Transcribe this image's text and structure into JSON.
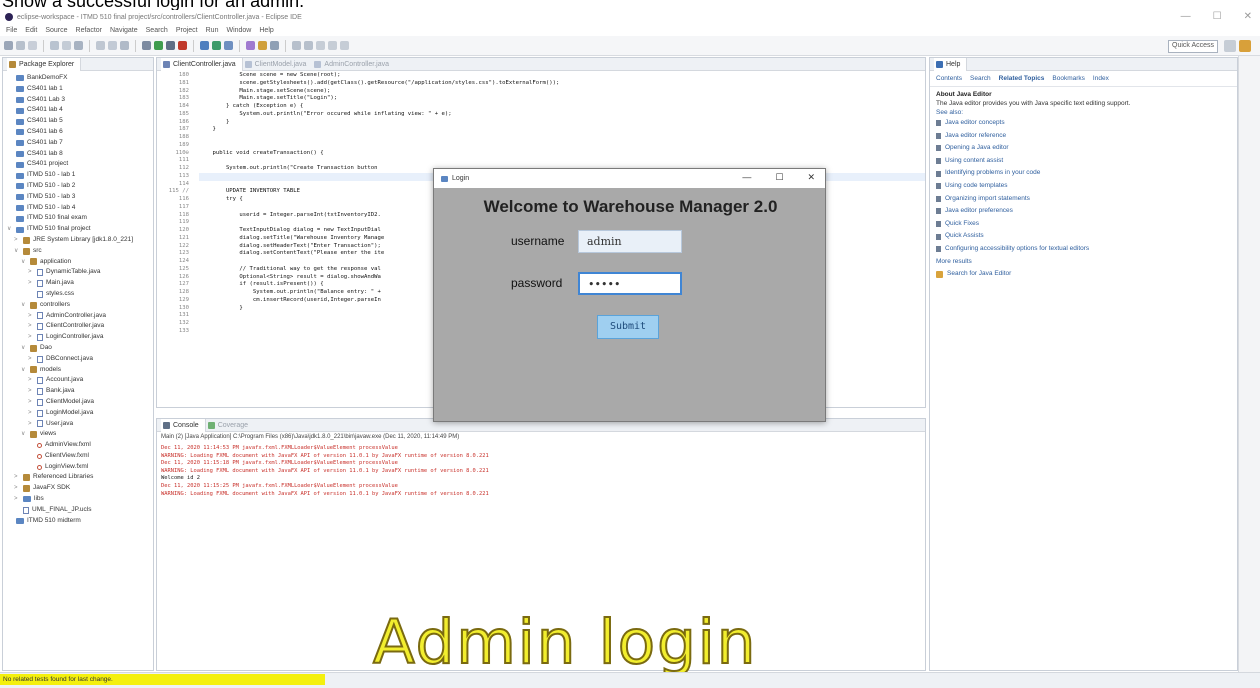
{
  "caption": "Show a successful login for an admin.",
  "window": {
    "title": "eclipse-workspace - ITMD 510 final project/src/controllers/ClientController.java - Eclipse IDE",
    "controls": [
      "—",
      "☐",
      "✕"
    ]
  },
  "menu": [
    "File",
    "Edit",
    "Source",
    "Refactor",
    "Navigate",
    "Search",
    "Project",
    "Run",
    "Window",
    "Help"
  ],
  "toolbar": {
    "quick_access": "Quick Access"
  },
  "package_explorer": {
    "tab": "Package Explorer",
    "items": [
      {
        "label": "BankDemoFX",
        "kind": "project",
        "depth": 0,
        "arrow": ""
      },
      {
        "label": "CS401 lab 1",
        "kind": "project",
        "depth": 0,
        "arrow": ""
      },
      {
        "label": "CS401 Lab 3",
        "kind": "project",
        "depth": 0,
        "arrow": ""
      },
      {
        "label": "CS401 lab 4",
        "kind": "project",
        "depth": 0,
        "arrow": ""
      },
      {
        "label": "CS401 lab 5",
        "kind": "project",
        "depth": 0,
        "arrow": ""
      },
      {
        "label": "CS401 lab 6",
        "kind": "project",
        "depth": 0,
        "arrow": ""
      },
      {
        "label": "CS401 lab 7",
        "kind": "project",
        "depth": 0,
        "arrow": ""
      },
      {
        "label": "CS401 lab 8",
        "kind": "project",
        "depth": 0,
        "arrow": ""
      },
      {
        "label": "CS401 project",
        "kind": "project",
        "depth": 0,
        "arrow": ""
      },
      {
        "label": "ITMD 510 - lab 1",
        "kind": "project",
        "depth": 0,
        "arrow": ""
      },
      {
        "label": "ITMD 510 - lab 2",
        "kind": "project",
        "depth": 0,
        "arrow": ""
      },
      {
        "label": "ITMD 510 - lab 3",
        "kind": "project",
        "depth": 0,
        "arrow": ""
      },
      {
        "label": "ITMD 510 - lab 4",
        "kind": "project",
        "depth": 0,
        "arrow": ""
      },
      {
        "label": "ITMD 510 final exam",
        "kind": "project",
        "depth": 0,
        "arrow": ""
      },
      {
        "label": "ITMD 510 final project",
        "kind": "project",
        "depth": 0,
        "arrow": "∨"
      },
      {
        "label": "JRE System Library [jdk1.8.0_221]",
        "kind": "lib",
        "depth": 1,
        "arrow": ">"
      },
      {
        "label": "src",
        "kind": "pkg",
        "depth": 1,
        "arrow": "∨"
      },
      {
        "label": "application",
        "kind": "pkg",
        "depth": 2,
        "arrow": "∨"
      },
      {
        "label": "DynamicTable.java",
        "kind": "java",
        "depth": 3,
        "arrow": ">"
      },
      {
        "label": "Main.java",
        "kind": "java",
        "depth": 3,
        "arrow": ">"
      },
      {
        "label": "styles.css",
        "kind": "css",
        "depth": 3,
        "arrow": ""
      },
      {
        "label": "controllers",
        "kind": "pkg",
        "depth": 2,
        "arrow": "∨"
      },
      {
        "label": "AdminController.java",
        "kind": "java",
        "depth": 3,
        "arrow": ">"
      },
      {
        "label": "ClientController.java",
        "kind": "java",
        "depth": 3,
        "arrow": ">"
      },
      {
        "label": "LoginController.java",
        "kind": "java",
        "depth": 3,
        "arrow": ">"
      },
      {
        "label": "Dao",
        "kind": "pkg",
        "depth": 2,
        "arrow": "∨"
      },
      {
        "label": "DBConnect.java",
        "kind": "java",
        "depth": 3,
        "arrow": ">"
      },
      {
        "label": "models",
        "kind": "pkg",
        "depth": 2,
        "arrow": "∨"
      },
      {
        "label": "Account.java",
        "kind": "java",
        "depth": 3,
        "arrow": ">"
      },
      {
        "label": "Bank.java",
        "kind": "java",
        "depth": 3,
        "arrow": ">"
      },
      {
        "label": "ClientModel.java",
        "kind": "java",
        "depth": 3,
        "arrow": ">"
      },
      {
        "label": "LoginModel.java",
        "kind": "java",
        "depth": 3,
        "arrow": ">"
      },
      {
        "label": "User.java",
        "kind": "java",
        "depth": 3,
        "arrow": ">"
      },
      {
        "label": "views",
        "kind": "pkg",
        "depth": 2,
        "arrow": "∨"
      },
      {
        "label": "AdminView.fxml",
        "kind": "fxml",
        "depth": 3,
        "arrow": ""
      },
      {
        "label": "ClientView.fxml",
        "kind": "fxml",
        "depth": 3,
        "arrow": ""
      },
      {
        "label": "LoginView.fxml",
        "kind": "fxml",
        "depth": 3,
        "arrow": ""
      },
      {
        "label": "Referenced Libraries",
        "kind": "lib",
        "depth": 1,
        "arrow": ">"
      },
      {
        "label": "JavaFX SDK",
        "kind": "lib",
        "depth": 1,
        "arrow": ">"
      },
      {
        "label": "libs",
        "kind": "folder",
        "depth": 1,
        "arrow": ">"
      },
      {
        "label": "UML_FINAL_JP.ucls",
        "kind": "file",
        "depth": 1,
        "arrow": ""
      },
      {
        "label": "ITMD 510 midterm",
        "kind": "project",
        "depth": 0,
        "arrow": ""
      }
    ]
  },
  "editor": {
    "tabs": [
      "ClientController.java",
      "ClientModel.java",
      "AdminController.java"
    ],
    "line_numbers": [
      "180",
      "181",
      "182",
      "183",
      "184",
      "185",
      "186",
      "187",
      "188",
      "189",
      "110⊖",
      "111",
      "112",
      "113",
      "114",
      "115 //",
      "116",
      "117",
      "118",
      "119",
      "120",
      "121",
      "122",
      "123",
      "124",
      "125",
      "126",
      "127",
      "128",
      "129",
      "130",
      "131",
      "132",
      "133"
    ],
    "lines": [
      "            Scene scene = new Scene(root);",
      "            scene.getStylesheets().add(getClass().getResource(\"/application/styles.css\").toExternalForm());",
      "            Main.stage.setScene(scene);",
      "            Main.stage.setTitle(\"Login\");",
      "        } catch (Exception e) {",
      "            System.out.println(\"Error occured while inflating view: \" + e);",
      "        }",
      "    }",
      "",
      "",
      "    public void createTransaction() {",
      "",
      "        System.out.println(\"Create Transaction button ",
      "",
      "",
      "        UPDATE INVENTORY TABLE",
      "        try {",
      "",
      "            userid = Integer.parseInt(txtInventoryID2.",
      "",
      "            TextInputDialog dialog = new TextInputDial",
      "            dialog.setTitle(\"Warehouse Inventory Manage",
      "            dialog.setHeaderText(\"Enter Transaction\");",
      "            dialog.setContentText(\"Please enter the ite",
      "",
      "            // Traditional way to get the response val",
      "            Optional<String> result = dialog.showAndWa",
      "            if (result.isPresent()) {",
      "                System.out.println(\"Balance entry: \" +",
      "                cm.insertRecord(userid,Integer.parseIn",
      "            }",
      "",
      "",
      ""
    ]
  },
  "console": {
    "tabs": [
      "Console",
      "Coverage"
    ],
    "path": "Main (2) [Java Application] C:\\Program Files (x86)\\Java\\jdk1.8.0_221\\bin\\javaw.exe (Dec 11, 2020, 11:14:49 PM)",
    "lines": [
      {
        "text": "Dec 11, 2020 11:14:53 PM javafx.fxml.FXMLLoader$ValueElement processValue",
        "color": "red"
      },
      {
        "text": "WARNING: Loading FXML document with JavaFX API of version 11.0.1 by JavaFX runtime of version 8.0.221",
        "color": "red"
      },
      {
        "text": "Dec 11, 2020 11:15:18 PM javafx.fxml.FXMLLoader$ValueElement processValue",
        "color": "red"
      },
      {
        "text": "WARNING: Loading FXML document with JavaFX API of version 11.0.1 by JavaFX runtime of version 8.0.221",
        "color": "red"
      },
      {
        "text": "Welcome id 2",
        "color": "black"
      },
      {
        "text": "Dec 11, 2020 11:15:25 PM javafx.fxml.FXMLLoader$ValueElement processValue",
        "color": "red"
      },
      {
        "text": "WARNING: Loading FXML document with JavaFX API of version 11.0.1 by JavaFX runtime of version 8.0.221",
        "color": "red"
      }
    ]
  },
  "help": {
    "tab": "Help",
    "tabs": [
      "Contents",
      "Search",
      "Related Topics",
      "Bookmarks",
      "Index"
    ],
    "heading": "About Java Editor",
    "description": "The Java editor provides you with Java specific text editing support.",
    "see_also": "See also:",
    "links": [
      "Java editor concepts",
      "Java editor reference",
      "Opening a Java editor",
      "Using content assist",
      "Identifying problems in your code",
      "Using code templates",
      "Organizing import statements",
      "Java editor preferences",
      "Quick Fixes",
      "Quick Assists",
      "Configuring accessibility options for textual editors"
    ],
    "more_results": "More results",
    "search_link": "Search for Java Editor"
  },
  "login_dialog": {
    "title": "Login",
    "controls": [
      "—",
      "☐",
      "✕"
    ],
    "welcome": "Welcome to Warehouse Manager 2.0",
    "username_label": "username",
    "username_value": "admin",
    "password_label": "password",
    "password_value": "•••••",
    "submit_label": "Submit"
  },
  "overlay": "Admin login",
  "status": {
    "message": "No related tests found for last change."
  },
  "colors": {
    "dialog_bg": "#a9a9a9",
    "submit_bg": "#9fcff0",
    "overlay_text": "#f2ee2e",
    "status_highlight": "#f4f00e",
    "console_error": "#c8312b"
  }
}
